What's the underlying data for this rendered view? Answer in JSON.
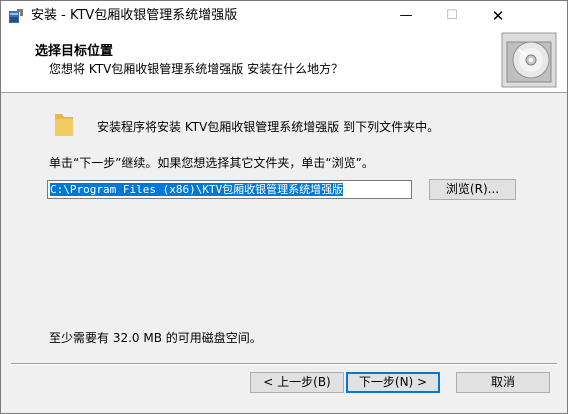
{
  "window": {
    "title": "安装 - KTV包厢收银管理系统增强版",
    "minimize_glyph": "—",
    "maximize_glyph": "☐",
    "close_glyph": "✕"
  },
  "header": {
    "title": "选择目标位置",
    "subtitle": "您想将 KTV包厢收银管理系统增强版 安装在什么地方？"
  },
  "content": {
    "install_message": "安装程序将安装 KTV包厢收银管理系统增强版 到下列文件夹中。",
    "click_message": "单击“下一步”继续。如果您想选择其它文件夹，单击“浏览”。",
    "path_value": "C:\\Program Files (x86)\\KTV包厢收银管理系统增强版",
    "browse_label": "浏览(R)...",
    "space_message": "至少需要有 32.0 MB 的可用磁盘空间。"
  },
  "buttons": {
    "back": "< 上一步(B)",
    "next": "下一步(N) >",
    "cancel": "取消"
  },
  "icons": {
    "app": "installer-app-icon",
    "header": "disc-icon",
    "folder": "folder-icon"
  },
  "colors": {
    "selection": "#0078d7",
    "folder": "#e8b84a"
  }
}
